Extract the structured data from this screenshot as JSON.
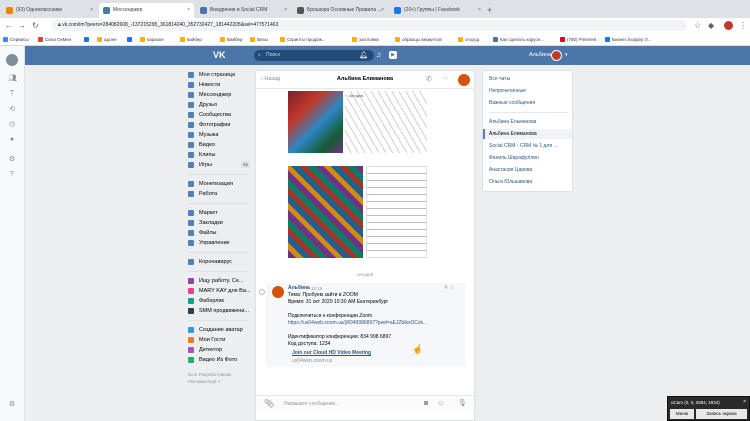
{
  "browser": {
    "tabs": [
      {
        "title": "(93) Одноклассники",
        "color": "#ee8208"
      },
      {
        "title": "Мессенджер",
        "color": "#4a76a8",
        "active": true
      },
      {
        "title": "Внедрение в Social CRM",
        "color": "#4a76a8"
      },
      {
        "title": "Брошюра Основные Правила ...",
        "color": "#555555"
      },
      {
        "title": "(20+) Группы | Facebook",
        "color": "#1877f2"
      }
    ],
    "new_tab": "+",
    "url": "vk.com/im?peers=284082608_-137215295_361814240_352732427_181442205&sel=477571463",
    "bookmarks": [
      "Сервисы",
      "Сила ОкМен",
      "",
      "адоне",
      "",
      "караоке",
      "вайбер",
      "Вайбер",
      "Визы",
      "Скрипты продаж...",
      "заготовки",
      "образцы аккаунтов",
      "огород",
      "Как сделать карусе...",
      "(780) Pinterest",
      "Бизнес Бордер Л..."
    ]
  },
  "vk": {
    "logo": "VK",
    "search_placeholder": "Поиск",
    "user_name": "Альбина"
  },
  "menu": {
    "items": [
      {
        "label": "Моя страница"
      },
      {
        "label": "Новости"
      },
      {
        "label": "Мессенджер"
      },
      {
        "label": "Друзья"
      },
      {
        "label": "Сообщества"
      },
      {
        "label": "Фотографии"
      },
      {
        "label": "Музыка"
      },
      {
        "label": "Видео"
      },
      {
        "label": "Клипы"
      },
      {
        "label": "Игры",
        "count": "56"
      }
    ],
    "items2": [
      {
        "label": "Монетизация"
      },
      {
        "label": "Работа"
      }
    ],
    "items3": [
      {
        "label": "Маркет"
      },
      {
        "label": "Закладки"
      },
      {
        "label": "Файлы"
      },
      {
        "label": "Управление"
      }
    ],
    "items4": [
      {
        "label": "Коронавирус"
      }
    ],
    "items5": [
      {
        "label": "Ищу работу. Се..."
      },
      {
        "label": "MARY KAY для Ва..."
      },
      {
        "label": "Фаберлик"
      },
      {
        "label": "SMM продвижени..."
      }
    ],
    "items6": [
      {
        "label": "Создание аватар"
      },
      {
        "label": "Мои Гости"
      },
      {
        "label": "Детектор"
      },
      {
        "label": "Видео Из Фото"
      }
    ],
    "footer": [
      "Блог  Разработчикам",
      "Реклама  Ещё ˅"
    ]
  },
  "chat": {
    "back_label": "Назад",
    "title": "Альбина Елиманова",
    "day_label": "сегодня",
    "photo_caption": "сегодня",
    "message": {
      "author": "Альбина",
      "time": "12:16",
      "lines": [
        "Тема: Пробуем зайти в ZOOM",
        "Время: 31 окт 2020 10:30 AM Екатеринбург",
        "",
        "Подключиться к конференции Zoom",
        "https://us04web.zoom.us/j/8349986897?pwd=aEJZblkxOCzk...",
        "",
        "Идентификатор конференции: 834 998 6897",
        "Код доступа: 1234"
      ],
      "link_title": "Join our Cloud HD Video Meeting",
      "link_host": "us04web.zoom.us"
    },
    "composer_placeholder": "Напишите сообщение..."
  },
  "right_panel": {
    "filters": [
      "Все чаты",
      "Непрочитанные",
      "Важные сообщения"
    ],
    "chats": [
      "Альбина Ельманова",
      "Альбина Елиманова",
      "Social CRM - CRM № 1 для ...",
      "Фаниль Шарафуллин",
      "Анастасия Царева",
      "Ольга Юльшавова"
    ],
    "selected_index": 1
  },
  "ucam": {
    "title": "uCam (0, 0, 2884, 1834)",
    "close": "×",
    "btn_menu": "Меню",
    "btn_record": "Запись экрана"
  }
}
